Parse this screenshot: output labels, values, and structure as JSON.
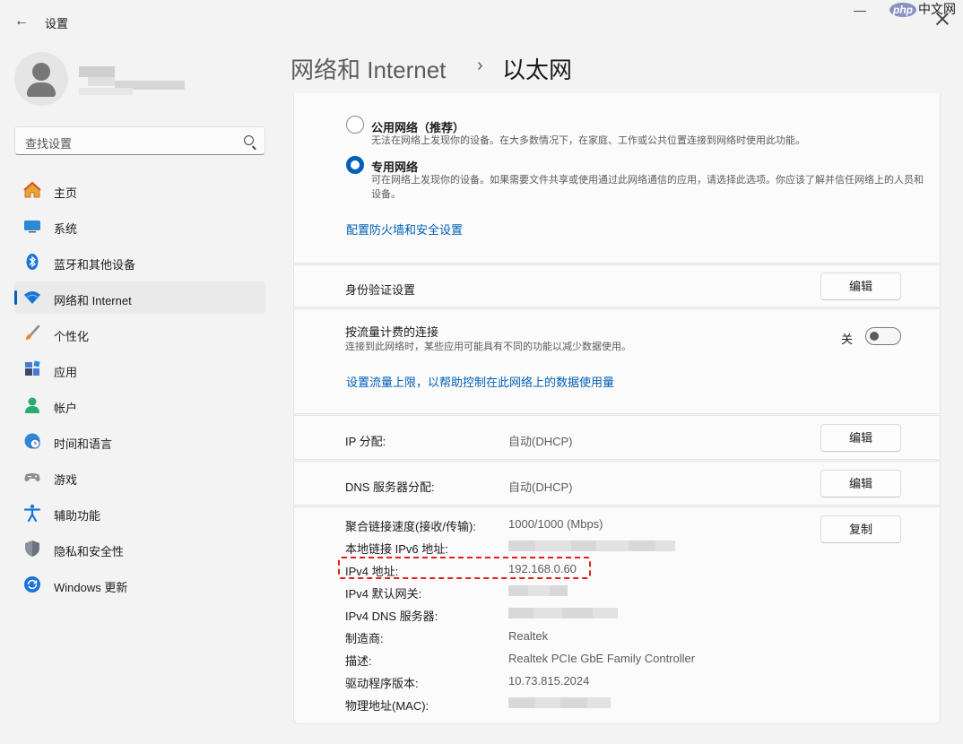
{
  "window": {
    "title": "设置",
    "watermark_badge": "php",
    "watermark_text": "中文网"
  },
  "search": {
    "placeholder": "查找设置"
  },
  "nav": {
    "items": [
      {
        "label": "主页",
        "icon": "home-icon"
      },
      {
        "label": "系统",
        "icon": "monitor-icon"
      },
      {
        "label": "蓝牙和其他设备",
        "icon": "bluetooth-icon"
      },
      {
        "label": "网络和 Internet",
        "icon": "wifi-icon",
        "active": true
      },
      {
        "label": "个性化",
        "icon": "brush-icon"
      },
      {
        "label": "应用",
        "icon": "apps-icon"
      },
      {
        "label": "帐户",
        "icon": "account-icon"
      },
      {
        "label": "时间和语言",
        "icon": "clock-globe-icon"
      },
      {
        "label": "游戏",
        "icon": "gamepad-icon"
      },
      {
        "label": "辅助功能",
        "icon": "accessibility-icon"
      },
      {
        "label": "隐私和安全性",
        "icon": "shield-icon"
      },
      {
        "label": "Windows 更新",
        "icon": "update-icon"
      }
    ]
  },
  "header": {
    "parent": "网络和 Internet",
    "separator": "›",
    "current": "以太网"
  },
  "profile_type": {
    "public": {
      "title": "公用网络（推荐）",
      "desc": "无法在网络上发现你的设备。在大多数情况下，在家庭、工作或公共位置连接到网络时使用此功能。",
      "checked": false
    },
    "private": {
      "title": "专用网络",
      "desc": "可在网络上发现你的设备。如果需要文件共享或使用通过此网络通信的应用，请选择此选项。你应该了解并信任网络上的人员和设备。",
      "checked": true
    },
    "firewall_link": "配置防火墙和安全设置"
  },
  "auth": {
    "label": "身份验证设置",
    "button": "编辑"
  },
  "metered": {
    "label": "按流量计费的连接",
    "desc": "连接到此网络时，某些应用可能具有不同的功能以减少数据使用。",
    "state_label": "关",
    "on": false,
    "link": "设置流量上限，以帮助控制在此网络上的数据使用量"
  },
  "ip_assignment": {
    "label": "IP 分配:",
    "value": "自动(DHCP)",
    "button": "编辑"
  },
  "dns_assignment": {
    "label": "DNS 服务器分配:",
    "value": "自动(DHCP)",
    "button": "编辑"
  },
  "properties": {
    "copy_button": "复制",
    "rows": [
      {
        "label": "聚合链接速度(接收/传输):",
        "value": "1000/1000 (Mbps)"
      },
      {
        "label": "本地链接 IPv6 地址:",
        "value": ""
      },
      {
        "label": "IPv4 地址:",
        "value": "192.168.0.60"
      },
      {
        "label": "IPv4 默认网关:",
        "value": ""
      },
      {
        "label": "IPv4 DNS 服务器:",
        "value": ""
      },
      {
        "label": "制造商:",
        "value": "Realtek"
      },
      {
        "label": "描述:",
        "value": "Realtek PCIe GbE Family Controller"
      },
      {
        "label": "驱动程序版本:",
        "value": "10.73.815.2024"
      },
      {
        "label": "物理地址(MAC):",
        "value": ""
      }
    ]
  }
}
